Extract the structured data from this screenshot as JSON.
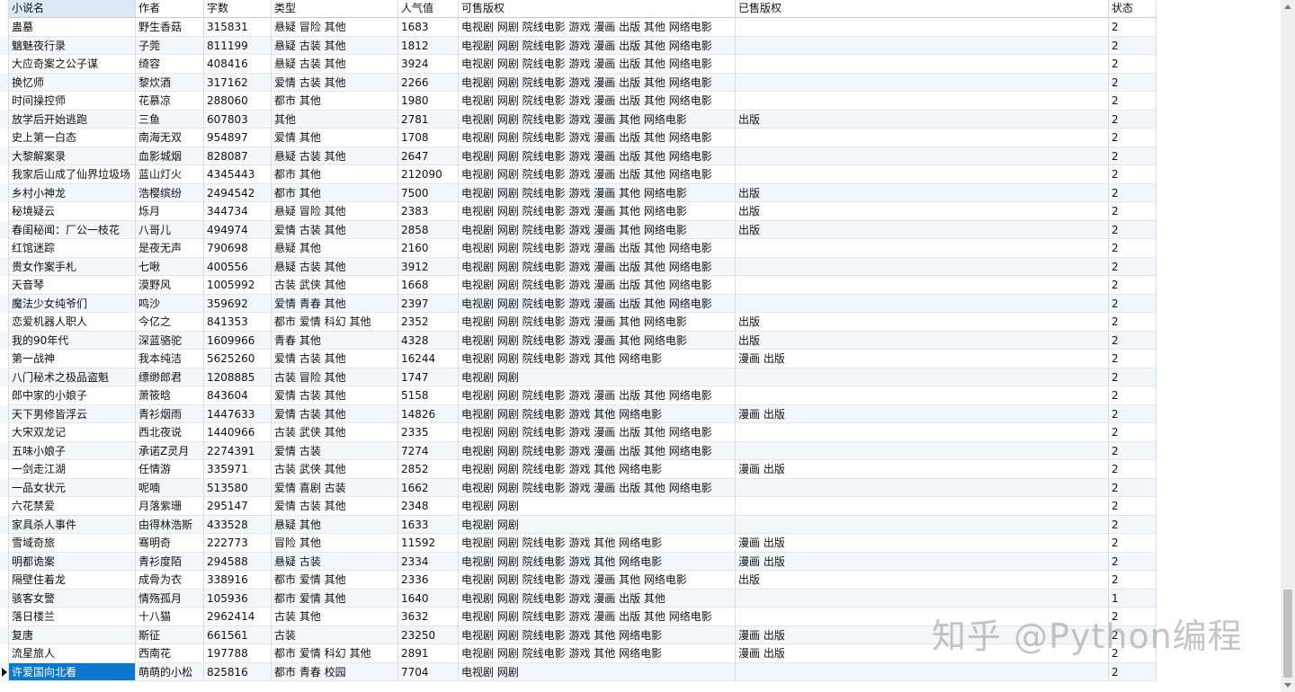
{
  "columns": [
    "小说名",
    "作者",
    "字数",
    "类型",
    "人气值",
    "可售版权",
    "已售版权",
    "状态"
  ],
  "rows": [
    [
      "蛊墓",
      "野生香菇",
      "315831",
      "悬疑 冒险 其他",
      "1683",
      "电视剧 网剧 院线电影 游戏 漫画 出版 其他 网络电影",
      "",
      "2"
    ],
    [
      "魑魅夜行录",
      "子莞",
      "811199",
      "悬疑 古装 其他",
      "1812",
      "电视剧 网剧 院线电影 游戏 漫画 出版 其他 网络电影",
      "",
      "2"
    ],
    [
      "大应奇案之公子谋",
      "绮容",
      "408416",
      "悬疑 古装 其他",
      "3924",
      "电视剧 网剧 院线电影 游戏 漫画 出版 其他 网络电影",
      "",
      "2"
    ],
    [
      "换忆师",
      "黎炊酒",
      "317162",
      "爱情 古装 其他",
      "2266",
      "电视剧 网剧 院线电影 游戏 漫画 出版 其他 网络电影",
      "",
      "2"
    ],
    [
      "时间操控师",
      "花慕凉",
      "288060",
      "都市 其他",
      "1980",
      "电视剧 网剧 院线电影 游戏 漫画 出版 其他 网络电影",
      "",
      "2"
    ],
    [
      "放学后开始逃跑",
      "三鱼",
      "607803",
      "其他",
      "2781",
      "电视剧 网剧 院线电影 游戏 漫画 其他 网络电影",
      "出版",
      "2"
    ],
    [
      "史上第一白态",
      "南海无双",
      "954897",
      "爱情 其他",
      "1708",
      "电视剧 网剧 院线电影 游戏 漫画 出版 其他 网络电影",
      "",
      "2"
    ],
    [
      "大黎解案录",
      "血影城烟",
      "828087",
      "悬疑 古装 其他",
      "2647",
      "电视剧 网剧 院线电影 游戏 漫画 出版 其他 网络电影",
      "",
      "2"
    ],
    [
      "我家后山成了仙界垃圾场",
      "蓝山灯火",
      "4345443",
      "都市 其他",
      "212090",
      "电视剧 网剧 院线电影 游戏 漫画 出版 其他 网络电影",
      "",
      "2"
    ],
    [
      "乡村小神龙",
      "浩樱缤纷",
      "2494542",
      "都市 其他",
      "7500",
      "电视剧 网剧 院线电影 游戏 漫画 其他 网络电影",
      "出版",
      "2"
    ],
    [
      "秘境疑云",
      "烁月",
      "344734",
      "悬疑 冒险 其他",
      "2383",
      "电视剧 网剧 院线电影 游戏 漫画 其他 网络电影",
      "出版",
      "2"
    ],
    [
      "春闺秘闻：厂公一枝花",
      "八哥儿",
      "494974",
      "爱情 古装 其他",
      "2858",
      "电视剧 网剧 院线电影 游戏 漫画 其他 网络电影",
      "出版",
      "2"
    ],
    [
      "红馆迷踪",
      "是夜无声",
      "790698",
      "悬疑 其他",
      "2160",
      "电视剧 网剧 院线电影 游戏 漫画 出版 其他 网络电影",
      "",
      "2"
    ],
    [
      "贵女作案手札",
      "七啾",
      "400556",
      "悬疑 古装 其他",
      "3912",
      "电视剧 网剧 院线电影 游戏 漫画 出版 其他 网络电影",
      "",
      "2"
    ],
    [
      "天音琴",
      "漠野风",
      "1005992",
      "古装 武侠 其他",
      "1668",
      "电视剧 网剧 院线电影 游戏 漫画 出版 其他 网络电影",
      "",
      "2"
    ],
    [
      "魔法少女纯爷们",
      "鸣沙",
      "359692",
      "爱情 青春 其他",
      "2397",
      "电视剧 网剧 院线电影 游戏 漫画 出版 其他 网络电影",
      "",
      "2"
    ],
    [
      "恋爱机器人职人",
      "今亿之",
      "841353",
      "都市 爱情 科幻 其他",
      "2352",
      "电视剧 网剧 院线电影 游戏 漫画 其他 网络电影",
      "出版",
      "2"
    ],
    [
      "我的90年代",
      "深蓝骆驼",
      "1609966",
      "青春 其他",
      "4328",
      "电视剧 网剧 院线电影 游戏 漫画 其他 网络电影",
      "出版",
      "2"
    ],
    [
      "第一战神",
      "我本纯洁",
      "5625260",
      "爱情 古装 其他",
      "16244",
      "电视剧 网剧 院线电影 游戏 其他 网络电影",
      "漫画 出版",
      "2"
    ],
    [
      "八门秘术之极品盗魁",
      "缥缈郎君",
      "1208885",
      "古装 冒险 其他",
      "1747",
      "电视剧 网剧",
      "",
      "2"
    ],
    [
      "郎中家的小娘子",
      "萧筱晗",
      "843604",
      "爱情 古装 其他",
      "5158",
      "电视剧 网剧 院线电影 游戏 漫画 出版 其他 网络电影",
      "",
      "2"
    ],
    [
      "天下男修皆浮云",
      "青衫烟雨",
      "1447633",
      "爱情 古装 其他",
      "14826",
      "电视剧 网剧 院线电影 游戏 其他 网络电影",
      "漫画 出版",
      "2"
    ],
    [
      "大宋双龙记",
      "西北夜说",
      "1440966",
      "古装 武侠 其他",
      "2335",
      "电视剧 网剧 院线电影 游戏 漫画 出版 其他 网络电影",
      "",
      "2"
    ],
    [
      "五味小娘子",
      "承诺Z灵月",
      "2274391",
      "爱情 古装",
      "7274",
      "电视剧 网剧 院线电影 游戏 漫画 出版 其他 网络电影",
      "",
      "2"
    ],
    [
      "一剑走江湖",
      "任情游",
      "335971",
      "古装 武侠 其他",
      "2852",
      "电视剧 网剧 院线电影 游戏 其他 网络电影",
      "漫画 出版",
      "2"
    ],
    [
      "一品女状元",
      "呢喃",
      "513580",
      "爱情 喜剧 古装",
      "1662",
      "电视剧 网剧 院线电影 游戏 漫画 出版 其他 网络电影",
      "",
      "2"
    ],
    [
      "六花禁爱",
      "月落紫珊",
      "295147",
      "爱情 古装 其他",
      "2348",
      "电视剧 网剧",
      "",
      "2"
    ],
    [
      "家具杀人事件",
      "由得林浩斯",
      "433528",
      "悬疑 其他",
      "1633",
      "电视剧 网剧",
      "",
      "2"
    ],
    [
      "雪域奇旅",
      "骞明奇",
      "222773",
      "冒险 其他",
      "11592",
      "电视剧 网剧 院线电影 游戏 其他 网络电影",
      "漫画 出版",
      "2"
    ],
    [
      "明都诡案",
      "青衫度陌",
      "294588",
      "悬疑 古装",
      "2334",
      "电视剧 网剧 院线电影 游戏 其他 网络电影",
      "漫画 出版",
      "2"
    ],
    [
      "隔壁住着龙",
      "成骨为衣",
      "338916",
      "都市 爱情 其他",
      "2336",
      "电视剧 网剧 院线电影 游戏 漫画 其他 网络电影",
      "出版",
      "2"
    ],
    [
      "骇客女警",
      "情殇孤月",
      "105936",
      "都市 爱情 其他",
      "1640",
      "电视剧 网剧 院线电影 游戏 漫画 出版 其他",
      "",
      "1"
    ],
    [
      "落日楼兰",
      "十八猫",
      "2962414",
      "古装 其他",
      "3632",
      "电视剧 网剧 院线电影 游戏 漫画 出版 其他 网络电影",
      "",
      "2"
    ],
    [
      "复唐",
      "斯征",
      "661561",
      "古装",
      "23250",
      "电视剧 网剧 院线电影 游戏 其他 网络电影",
      "漫画 出版",
      "2"
    ],
    [
      "流星旅人",
      "西南花",
      "197788",
      "都市 爱情 科幻 其他",
      "2891",
      "电视剧 网剧 院线电影 游戏 其他 网络电影",
      "漫画 出版",
      "2"
    ],
    [
      "许爱国向北看",
      "萌萌的小松",
      "825816",
      "都市 青春 校园",
      "7704",
      "电视剧 网剧",
      "",
      "2"
    ]
  ],
  "selected_row": 35,
  "watermark": "知乎 @Python编程",
  "icons": {
    "row_pointer": "triangle-right-icon",
    "scroll_up": "arrow-up-icon",
    "scroll_down": "arrow-down-icon"
  }
}
